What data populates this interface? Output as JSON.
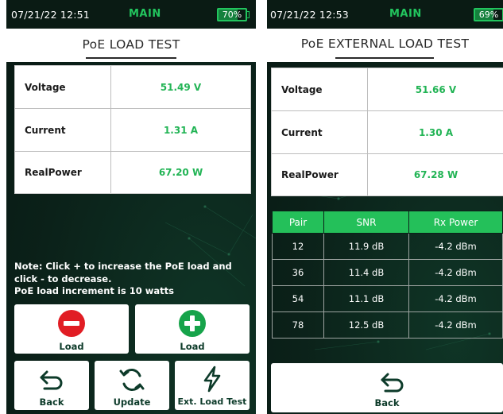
{
  "left": {
    "status": {
      "time": "07/21/22 12:51",
      "mode": "MAIN",
      "battery": "70%",
      "battery_level": 0.7
    },
    "title": "PoE LOAD TEST",
    "measurements": [
      {
        "label": "Voltage",
        "value": "51.49 V"
      },
      {
        "label": "Current",
        "value": "1.31 A"
      },
      {
        "label": "RealPower",
        "value": "67.20 W"
      }
    ],
    "note": {
      "line1": "Note: Click + to increase the PoE load and",
      "line2": "click - to decrease.",
      "line3": "PoE load increment is 10 watts"
    },
    "buttons": {
      "load_decrease": "Load",
      "load_increase": "Load",
      "back": "Back",
      "update": "Update",
      "ext_load_test": "Ext. Load Test"
    }
  },
  "right": {
    "status": {
      "time": "07/21/22 12:53",
      "mode": "MAIN",
      "battery": "69%",
      "battery_level": 0.69
    },
    "title": "PoE EXTERNAL LOAD TEST",
    "measurements": [
      {
        "label": "Voltage",
        "value": "51.66 V"
      },
      {
        "label": "Current",
        "value": "1.30 A"
      },
      {
        "label": "RealPower",
        "value": "67.28 W"
      }
    ],
    "snr_table": {
      "headers": [
        "Pair",
        "SNR",
        "Rx Power"
      ],
      "rows": [
        [
          "12",
          "11.9 dB",
          "-4.2 dBm"
        ],
        [
          "36",
          "11.4 dB",
          "-4.2 dBm"
        ],
        [
          "54",
          "11.1 dB",
          "-4.2 dBm"
        ],
        [
          "78",
          "12.5 dB",
          "-4.2 dBm"
        ]
      ]
    },
    "buttons": {
      "back": "Back"
    }
  },
  "colors": {
    "accent_green": "#22c55e",
    "value_green": "#22b455",
    "background_dark": "#0b2119",
    "minus_red": "#e11d24",
    "plus_green": "#16a34a",
    "button_label": "#0d3b2a"
  },
  "icons": {
    "minus": "minus-circle-icon",
    "plus": "plus-circle-icon",
    "back": "back-arrow-icon",
    "update": "refresh-icon",
    "ext_load": "lightning-bolt-icon"
  }
}
